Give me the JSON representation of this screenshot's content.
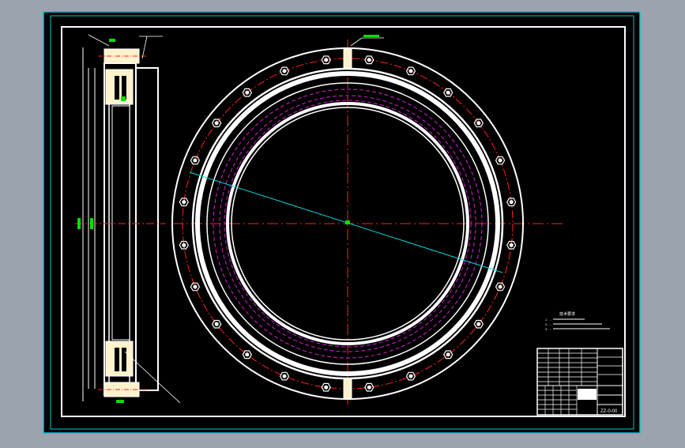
{
  "app": {
    "background": "#9aa4ae",
    "canvas_color": "#000000",
    "frame_color": "#ffffff",
    "border_color": "#00c8d0"
  },
  "drawing": {
    "notes_title": "技术要求",
    "notes": [
      "1. ...",
      "2. ...",
      "3. ..."
    ],
    "title_block": {
      "drawing_number": "ZZ-0-00"
    },
    "colors": {
      "outline": "#ffffff",
      "cream": "#fff2cc",
      "centerline": "#ff2020",
      "hidden": "#d020d0",
      "leader": "#00d8e0",
      "dimension": "#00e000",
      "bolt": "#ffffff"
    },
    "bolt_count": 24
  }
}
